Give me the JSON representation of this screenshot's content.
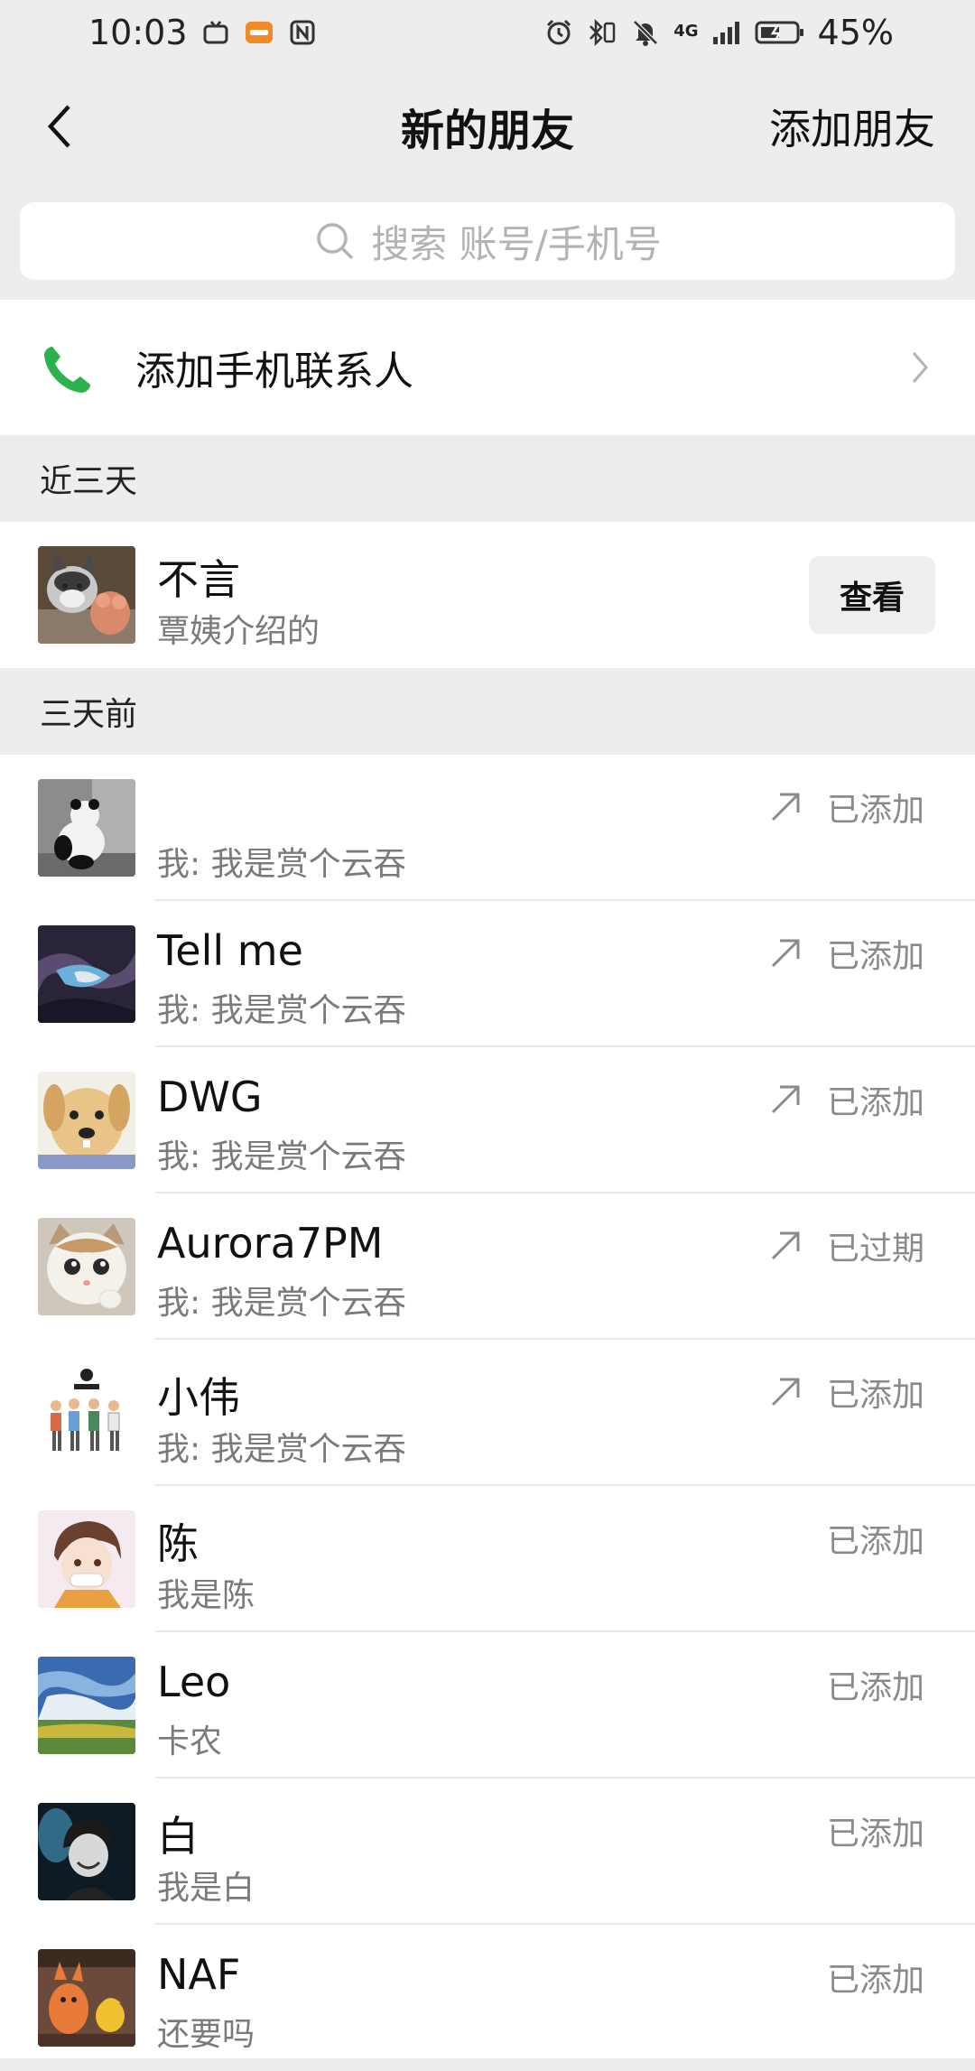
{
  "status_bar": {
    "time": "10:03",
    "network": "4G",
    "battery": "45%"
  },
  "nav": {
    "title": "新的朋友",
    "action": "添加朋友"
  },
  "search": {
    "placeholder": "搜索 账号/手机号"
  },
  "add_contacts": {
    "label": "添加手机联系人"
  },
  "sections": {
    "recent": "近三天",
    "older": "三天前"
  },
  "recent_requests": [
    {
      "name": "不言",
      "message": "覃姨介绍的",
      "action": "查看"
    }
  ],
  "older_requests": [
    {
      "name": "",
      "message": "我: 我是赏个云吞",
      "status": "已添加",
      "outgoing": true
    },
    {
      "name": "Tell me",
      "message": "我: 我是赏个云吞",
      "status": "已添加",
      "outgoing": true
    },
    {
      "name": "DWG",
      "message": "我: 我是赏个云吞",
      "status": "已添加",
      "outgoing": true
    },
    {
      "name": "Aurora7PM",
      "message": "我: 我是赏个云吞",
      "status": "已过期",
      "outgoing": true
    },
    {
      "name": "小伟",
      "message": "我: 我是赏个云吞",
      "status": "已添加",
      "outgoing": true
    },
    {
      "name": "陈",
      "message": "我是陈",
      "status": "已添加",
      "outgoing": false
    },
    {
      "name": "Leo",
      "message": "卡农",
      "status": "已添加",
      "outgoing": false
    },
    {
      "name": "白",
      "message": "我是白",
      "status": "已添加",
      "outgoing": false
    },
    {
      "name": "NAF",
      "message": "还要吗",
      "status": "已添加",
      "outgoing": false
    }
  ],
  "colors": {
    "background": "#ededed",
    "phone_icon": "#2bb24c",
    "muted_text": "#8a8a8a"
  }
}
